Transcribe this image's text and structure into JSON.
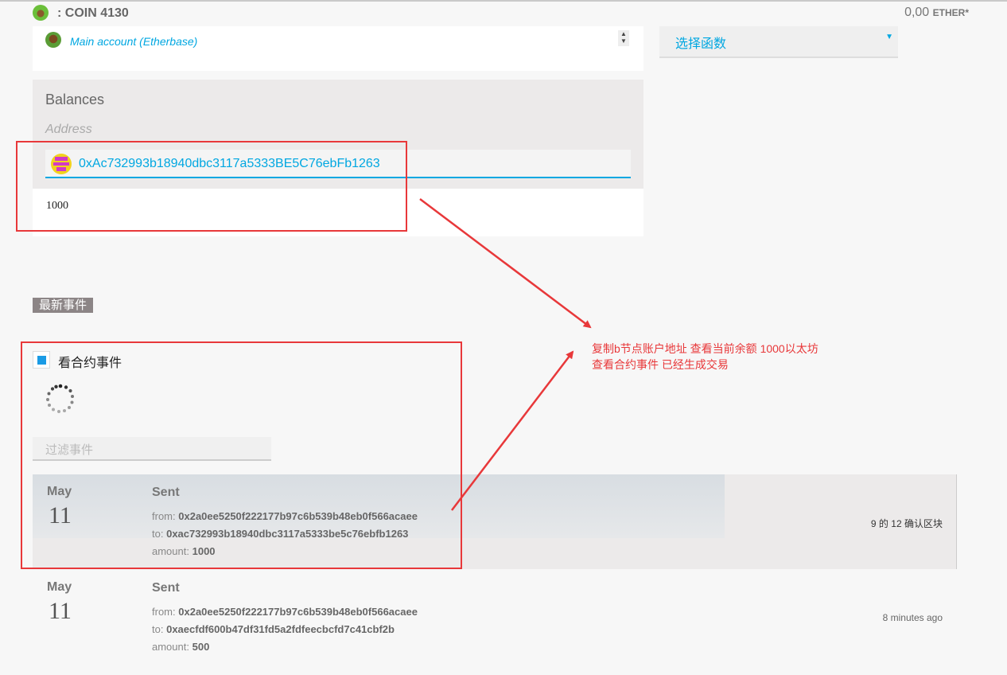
{
  "header": {
    "contract_title": ": COIN 4130",
    "balance_value": "0,00",
    "balance_unit": "ETHER*"
  },
  "account_select": {
    "label": "Main account (Etherbase)"
  },
  "function_select": {
    "label": "选择函数"
  },
  "balances": {
    "title": "Balances",
    "address_label": "Address",
    "address_value": "0xAc732993b18940dbc3117a5333BE5C76ebFb1263",
    "result": "1000"
  },
  "events": {
    "section_label": "最新事件",
    "watch_label": "看合约事件",
    "filter_placeholder": "过滤事件",
    "rows": [
      {
        "month": "May",
        "day": "11",
        "type": "Sent",
        "from_label": "from:",
        "from": "0x2a0ee5250f222177b97c6b539b48eb0f566acaee",
        "to_label": "to:",
        "to": "0xac732993b18940dbc3117a5333be5c76ebfb1263",
        "amount_label": "amount:",
        "amount": "1000",
        "status_a": "9",
        "status_of": "的",
        "status_b": "12",
        "status_suffix": "确认区块"
      },
      {
        "month": "May",
        "day": "11",
        "type": "Sent",
        "from_label": "from:",
        "from": "0x2a0ee5250f222177b97c6b539b48eb0f566acaee",
        "to_label": "to:",
        "to": "0xaecfdf600b47df31fd5a2fdfeecbcfd7c41cbf2b",
        "amount_label": "amount:",
        "amount": "500",
        "status": "8 minutes ago"
      }
    ]
  },
  "annotation": {
    "line1": "复制b节点账户地址  查看当前余额  1000以太坊",
    "line2": "查看合约事件  已经生成交易",
    "color": "#e8383a"
  },
  "accent_color": "#00a7e1"
}
